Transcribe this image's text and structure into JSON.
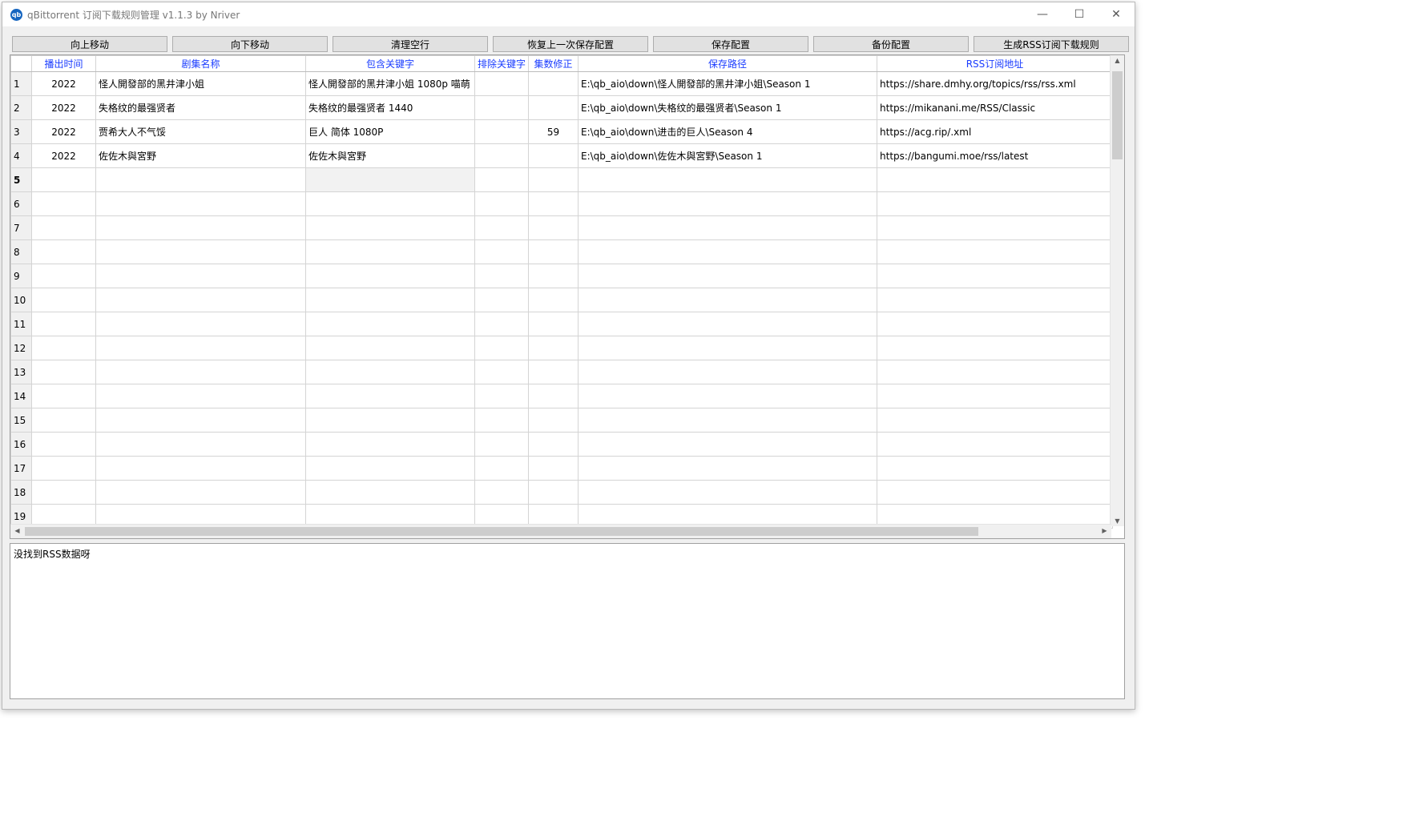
{
  "window": {
    "title": "qBittorrent 订阅下载规则管理 v1.1.3 by Nriver",
    "icon_text": "qb",
    "minimize": "—",
    "maximize": "☐",
    "close": "✕"
  },
  "toolbar": {
    "move_up": "向上移动",
    "move_down": "向下移动",
    "clear_empty": "清理空行",
    "restore_last": "恢复上一次保存配置",
    "save_config": "保存配置",
    "backup_config": "备份配置",
    "generate_rules": "生成RSS订阅下载规则"
  },
  "grid": {
    "headers": {
      "air_time": "播出时间",
      "series_name": "剧集名称",
      "include_keywords": "包含关键字",
      "exclude_keywords": "排除关键字",
      "episode_fix": "集数修正",
      "save_path": "保存路径",
      "rss_url": "RSS订阅地址"
    },
    "rows": [
      {
        "n": "1",
        "year": "2022",
        "name": "怪人開發部的黑井津小姐",
        "include": "怪人開發部的黑井津小姐 1080p 喵萌",
        "exclude": "",
        "fix": "",
        "path": "E:\\qb_aio\\down\\怪人開發部的黑井津小姐\\Season 1",
        "url": "https://share.dmhy.org/topics/rss/rss.xml"
      },
      {
        "n": "2",
        "year": "2022",
        "name": "失格纹的最强贤者",
        "include": "失格纹的最强贤者 1440",
        "exclude": "",
        "fix": "",
        "path": "E:\\qb_aio\\down\\失格纹的最强贤者\\Season 1",
        "url": "https://mikanani.me/RSS/Classic"
      },
      {
        "n": "3",
        "year": "2022",
        "name": "贾希大人不气馁",
        "include": "巨人 简体 1080P",
        "exclude": "",
        "fix": "59",
        "path": "E:\\qb_aio\\down\\进击的巨人\\Season 4",
        "url": "https://acg.rip/.xml"
      },
      {
        "n": "4",
        "year": "2022",
        "name": "佐佐木與宮野",
        "include": "佐佐木與宮野",
        "exclude": "",
        "fix": "",
        "path": "E:\\qb_aio\\down\\佐佐木與宮野\\Season 1",
        "url": "https://bangumi.moe/rss/latest"
      },
      {
        "n": "5",
        "year": "",
        "name": "",
        "include": "",
        "exclude": "",
        "fix": "",
        "path": "",
        "url": ""
      },
      {
        "n": "6",
        "year": "",
        "name": "",
        "include": "",
        "exclude": "",
        "fix": "",
        "path": "",
        "url": ""
      },
      {
        "n": "7",
        "year": "",
        "name": "",
        "include": "",
        "exclude": "",
        "fix": "",
        "path": "",
        "url": ""
      },
      {
        "n": "8",
        "year": "",
        "name": "",
        "include": "",
        "exclude": "",
        "fix": "",
        "path": "",
        "url": ""
      },
      {
        "n": "9",
        "year": "",
        "name": "",
        "include": "",
        "exclude": "",
        "fix": "",
        "path": "",
        "url": ""
      },
      {
        "n": "10",
        "year": "",
        "name": "",
        "include": "",
        "exclude": "",
        "fix": "",
        "path": "",
        "url": ""
      },
      {
        "n": "11",
        "year": "",
        "name": "",
        "include": "",
        "exclude": "",
        "fix": "",
        "path": "",
        "url": ""
      },
      {
        "n": "12",
        "year": "",
        "name": "",
        "include": "",
        "exclude": "",
        "fix": "",
        "path": "",
        "url": ""
      },
      {
        "n": "13",
        "year": "",
        "name": "",
        "include": "",
        "exclude": "",
        "fix": "",
        "path": "",
        "url": ""
      },
      {
        "n": "14",
        "year": "",
        "name": "",
        "include": "",
        "exclude": "",
        "fix": "",
        "path": "",
        "url": ""
      },
      {
        "n": "15",
        "year": "",
        "name": "",
        "include": "",
        "exclude": "",
        "fix": "",
        "path": "",
        "url": ""
      },
      {
        "n": "16",
        "year": "",
        "name": "",
        "include": "",
        "exclude": "",
        "fix": "",
        "path": "",
        "url": ""
      },
      {
        "n": "17",
        "year": "",
        "name": "",
        "include": "",
        "exclude": "",
        "fix": "",
        "path": "",
        "url": ""
      },
      {
        "n": "18",
        "year": "",
        "name": "",
        "include": "",
        "exclude": "",
        "fix": "",
        "path": "",
        "url": ""
      },
      {
        "n": "19",
        "year": "",
        "name": "",
        "include": "",
        "exclude": "",
        "fix": "",
        "path": "",
        "url": ""
      }
    ]
  },
  "log": {
    "text": "没找到RSS数据呀"
  },
  "colors": {
    "header_text": "#1a3cff",
    "window_bg": "#f0f0f0"
  }
}
